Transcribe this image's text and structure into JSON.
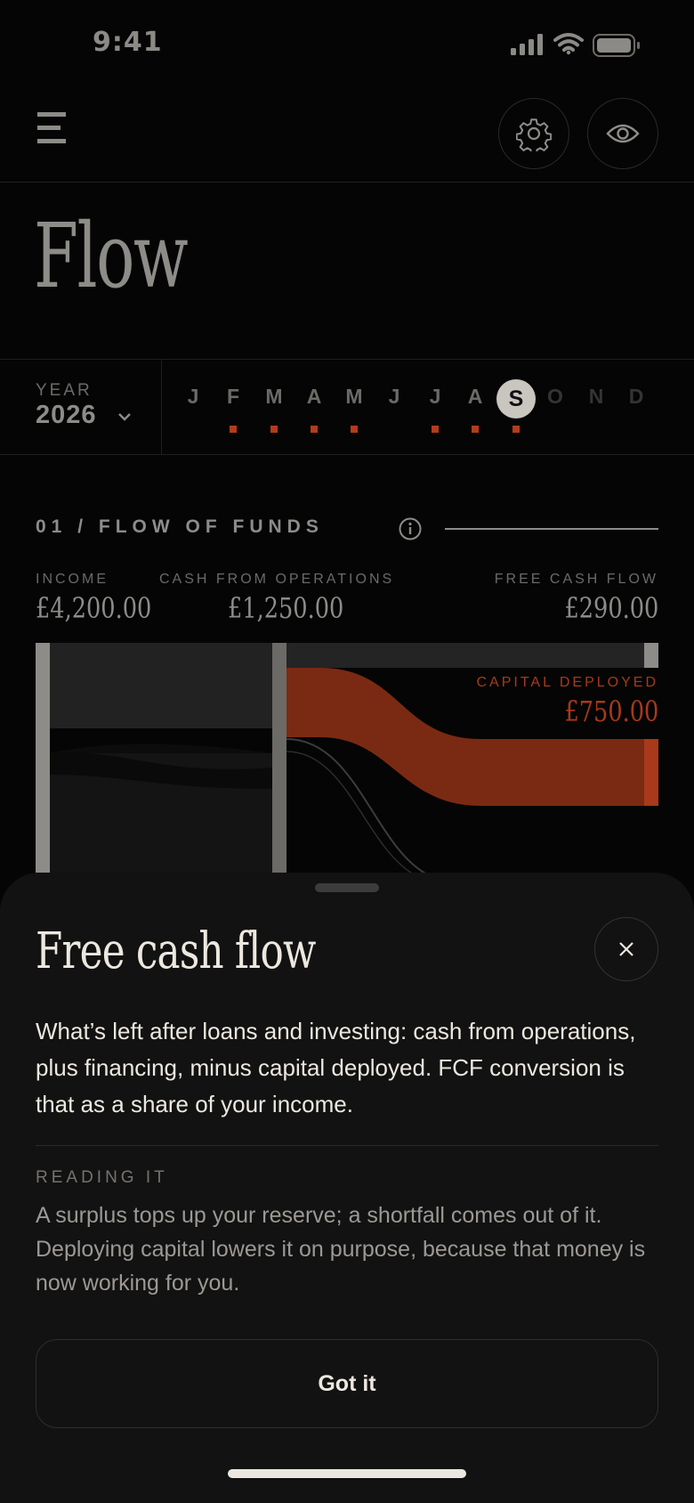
{
  "status_bar": {
    "time": "9:41"
  },
  "header": {
    "title": "Flow"
  },
  "period": {
    "year_label": "YEAR",
    "year_value": "2026",
    "months": [
      "J",
      "F",
      "M",
      "A",
      "M",
      "J",
      "J",
      "A",
      "S",
      "O",
      "N",
      "D"
    ],
    "selected_month": "S"
  },
  "section": {
    "title": "01 / FLOW OF FUNDS",
    "metrics": {
      "income": {
        "label": "INCOME",
        "value": "£4,200.00"
      },
      "cash_from_operations": {
        "label": "CASH FROM OPERATIONS",
        "value": "£1,250.00"
      },
      "free_cash_flow": {
        "label": "FREE CASH FLOW",
        "value": "£290.00"
      },
      "capital_deployed": {
        "label": "CAPITAL DEPLOYED",
        "value": "£750.00"
      }
    }
  },
  "sheet": {
    "title": "Free cash flow",
    "body": "What’s left after loans and investing: cash from operations, plus financing, minus capital deployed. FCF conversion is that as a share of your income.",
    "reading_label": "READING IT",
    "reading_body": "A surplus tops up your reserve; a shortfall comes out of it. Deploying capital lowers it on purpose, because that money is now working for you.",
    "button": "Got it"
  },
  "colors": {
    "background": "#050505",
    "accent": "#b23c1c",
    "sheet": "#121212",
    "muted_text": "#8e8c88"
  }
}
